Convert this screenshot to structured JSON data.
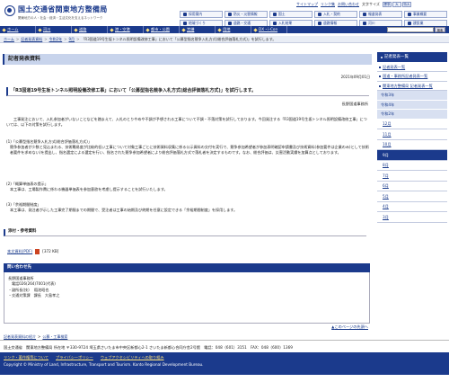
{
  "header": {
    "site_title": "国土交通省関東地方整備局",
    "site_subtitle": "関東地方の人・社会・経済・生活文化を支えるネットワーク",
    "links": [
      "サイトマップ",
      "リンク集",
      "お問い合わせ"
    ],
    "font_size_label": "文字サイズ",
    "font_sizes": [
      "標準",
      "大",
      "特大"
    ],
    "categories": [
      "採用案内",
      "防災・災害情報",
      "国土",
      "入札・契約",
      "報道発表",
      "事業概要",
      "地域づくり",
      "道路・交通",
      "入札結果",
      "道路情報",
      "河川",
      "建設業"
    ]
  },
  "nav": {
    "items": [
      "ホーム",
      "河川",
      "道路",
      "港・空港",
      "都市・公園",
      "営繕",
      "用地",
      "DX・i-Con"
    ],
    "search_placeholder": "",
    "search_button": "検索"
  },
  "breadcrumb": [
    "ホーム",
    "記者発表資料",
    "令和2年",
    "9月",
    "「R3国道19号生坂トンネル照明設備改修工事」において「公募型指名競争入札方式(総合評価落札方式)」を試行します。"
  ],
  "main": {
    "page_title": "記者発表資料",
    "date": "2021年09月01日",
    "article_title": "「R3国道19号生坂トンネル照明設備改修工事」において「公募型指名競争入札方式(総合評価落札方式)」を試行します。",
    "org": "長野国道事務所",
    "intro": "工事発注において、入札参加者がいないことなどを踏まえて、入札のとりやめや不調が予想される工事について不調・不落対策を試行しております。今回発注する「R3国道19号生坂トンネル照明設備改修工事」については、以下の対策を試行します。",
    "sections": [
      {
        "heading": "(1)「公募型指名競争入札方式(総合評価落札方式)」",
        "body": "競争参加者が少数と見込まれる、技術難易度が比較的低い工事について対象工事ごとに技術資料収集に係る公示資料の交付を実行で、競争参加希望者が参加表明確認申請書及び技術資料(参加要件は企業のみ)として技術者要件を求めない)を提出し、指名選定による選定を行い、指名された競争参加希望者により総合評価落札方式で落札者を決定するものです。なお、総合評価は、災害活動実績を加算点としております。"
      },
      {
        "heading": "(2)「概算単価表の提示」",
        "body": "本工事は、工場製作費に係わる機器単価表を参加意欲を考慮し提示することを試行いたします。"
      },
      {
        "heading": "(3)「余裕期間制度」",
        "body": "本工事は、発注者が示した工事完了期限までの期間で、受注者は工事の始期及び終期を任意に設定できる「余裕期間制度」を採用します。"
      }
    ],
    "ref_heading": "添付・参考資料",
    "ref_link": "本文資料(PDF)",
    "ref_size": "[372 KB]"
  },
  "contact": {
    "heading": "問い合わせ先",
    "lines": [
      "長野国道事務所",
      "電話026(264)7001(代表)",
      "・副所長(技)　 稲池昭也",
      "・交通対策課　課長　大島孝之"
    ]
  },
  "page_top": "このページの先頭へ",
  "sidebar": {
    "title": "記者発表一覧",
    "links": [
      "記者発表一覧",
      "国道・事務所記者発表一覧",
      "関東地方整備局 記者発表一覧"
    ],
    "years": [
      "令和3年",
      "令和4年",
      "令和2年"
    ],
    "months": [
      "12月",
      "11月",
      "10月",
      "9月",
      "8月",
      "7月",
      "6月",
      "5月",
      "4月",
      "3月"
    ],
    "active_month": "9月"
  },
  "footer": {
    "breadcrumb": [
      "記者発表資料の紹介",
      "公募・工事検索"
    ],
    "address": "国土交通省　関東地方整備局 所在地 〒330-9724 埼玉県さいたま市中央区新都心2-1 さいたま新都心合同庁舎2号館　電話：048（601）3151　FAX：048（600）1369",
    "links": [
      "リンク・著作権等について",
      "プライバシーポリシー",
      "ウェブアクセシビリティへの取り組み"
    ],
    "copyright": "Copyright © Ministry of Land, Infrastructure, Transport and Tourism. Kanto Regional Development Bureau."
  },
  "colors": {
    "brand": "#1b3a8c",
    "nav_bg": "#1b3a8c",
    "title_bg": "#c8d4ec"
  }
}
